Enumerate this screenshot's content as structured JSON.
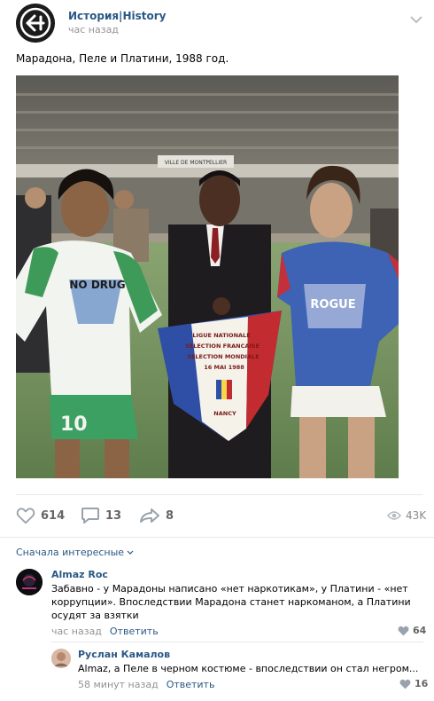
{
  "post": {
    "author": "История|History",
    "time": "час назад",
    "text": "Марадона, Пеле и Платини, 1988 год.",
    "photo": {
      "banner_text": "VILLE DE MONTPELLIER",
      "shirt_left_text": "NO DRUG",
      "shirt_left_number": "10",
      "shirt_right_text": "ROGUE",
      "pennant_lines": [
        "LIGUE NATIONALE",
        "SELECTION FRANCAISE",
        "SELECTION MONDIALE",
        "16 MAI 1988",
        "NANCY"
      ]
    }
  },
  "actions": {
    "likes": "614",
    "comments": "13",
    "shares": "8",
    "views": "43K"
  },
  "comments_sort": "Сначала интересные",
  "comments": [
    {
      "author": "Almaz Roc",
      "text": "Забавно - у Марадоны написано «нет наркотикам», у Платини - «нет коррупции». Впоследствии Марадона станет наркоманом, а Платини осудят за взятки",
      "time": "час назад",
      "reply": "Ответить",
      "likes": "64"
    },
    {
      "author": "Руслан Камалов",
      "text": "Almaz, а Пеле в черном костюме - впоследствии он стал негром...",
      "time": "58 минут назад",
      "reply": "Ответить",
      "likes": "16"
    }
  ],
  "colors": {
    "link": "#2a5885",
    "muted": "#939393",
    "icon": "#99a2ad"
  }
}
